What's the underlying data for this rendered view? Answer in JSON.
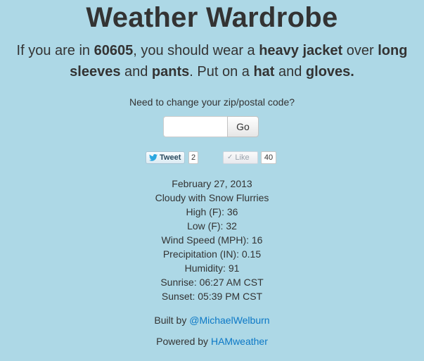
{
  "header": {
    "title": "Weather Wardrobe"
  },
  "advice": {
    "intro": "If you are in ",
    "zip": "60605",
    "mid1": ", you should wear a ",
    "outer": "heavy jacket",
    "mid2": " over ",
    "top": "long sleeves",
    "mid3": " and ",
    "bottom": "pants",
    "mid4": ". Put on a ",
    "accessory1": "hat",
    "mid5": " and ",
    "accessory2": "gloves."
  },
  "zip_form": {
    "prompt": "Need to change your zip/postal code?",
    "input_value": "",
    "go_label": "Go"
  },
  "social": {
    "tweet_label": "Tweet",
    "tweet_count": "2",
    "like_label": "Like",
    "like_count": "40",
    "twitter_color": "#2ca7e0"
  },
  "forecast": {
    "date": "February 27, 2013",
    "conditions": "Cloudy with Snow Flurries",
    "high": "High (F): 36",
    "low": "Low (F): 32",
    "wind": "Wind Speed (MPH): 16",
    "precip": "Precipitation (IN): 0.15",
    "humidity": "Humidity: 91",
    "sunrise": "Sunrise: 06:27 AM CST",
    "sunset": "Sunset: 05:39 PM CST"
  },
  "footer": {
    "built_by_text": "Built by ",
    "built_by_link": "@MichaelWelburn",
    "powered_by_text": "Powered by ",
    "powered_by_link": "HAMweather"
  },
  "colors": {
    "background": "#add8e6",
    "text": "#333333",
    "link": "#0c78c6"
  },
  "icons": {
    "tweet": "twitter-bird-icon",
    "like": "checkmark-icon"
  }
}
